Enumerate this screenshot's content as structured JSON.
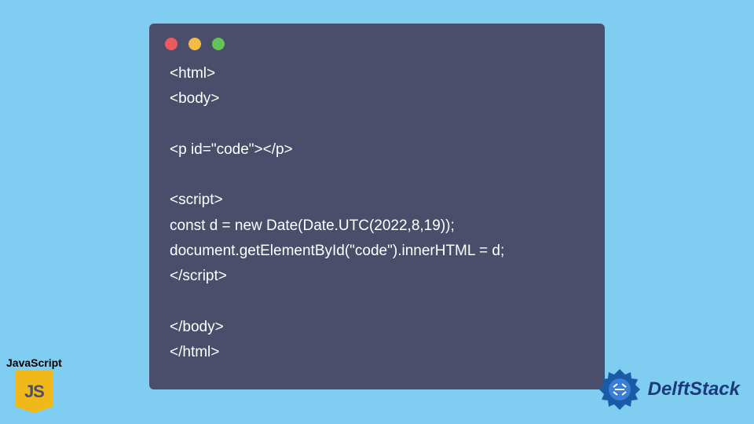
{
  "code": {
    "lines": [
      "<html>",
      "<body>",
      "",
      "<p id=\"code\"></p>",
      "",
      "<script>",
      "const d = new Date(Date.UTC(2022,8,19));",
      "document.getElementById(\"code\").innerHTML = d;",
      "</script>",
      "",
      "</body>",
      "</html>"
    ]
  },
  "jsBadge": {
    "label": "JavaScript",
    "logoText": "JS"
  },
  "delftBadge": {
    "text": "DelftStack"
  }
}
